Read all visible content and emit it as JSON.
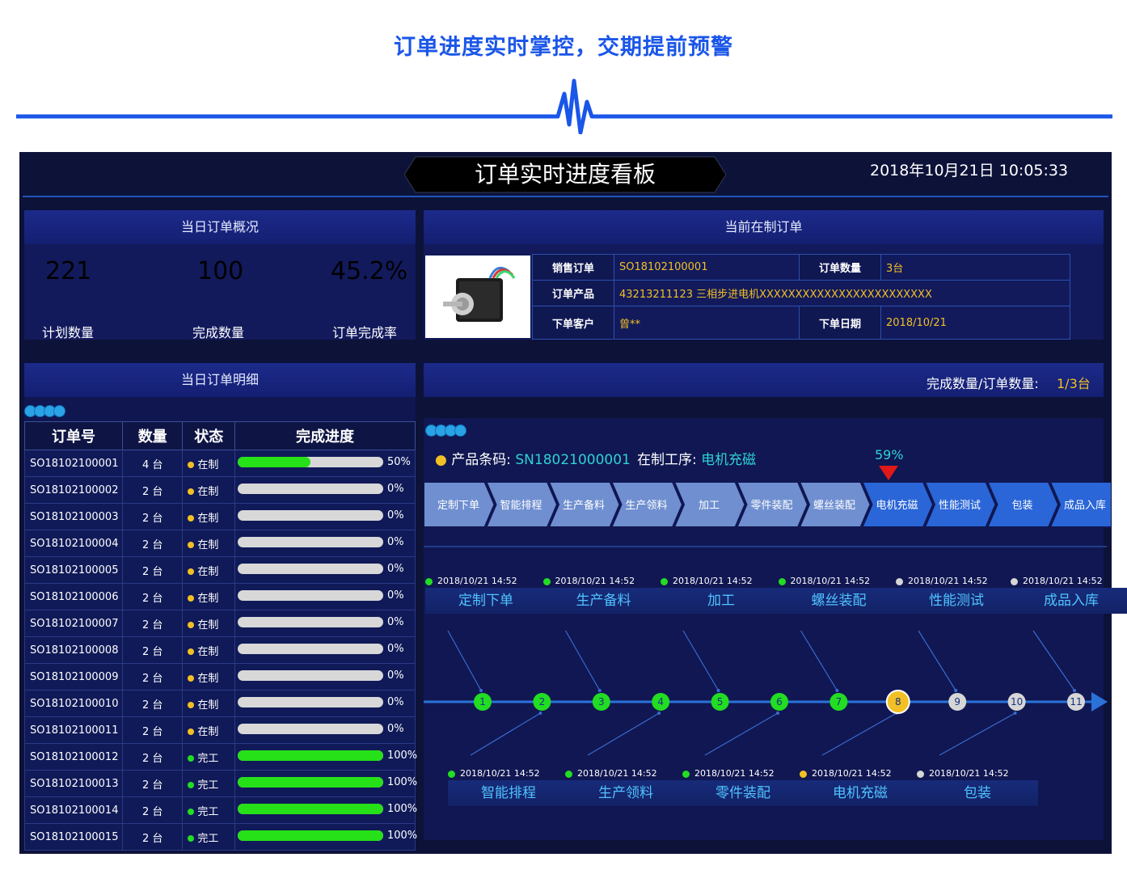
{
  "page_heading": "订单进度实时掌控，交期提前预警",
  "dashboard": {
    "title": "订单实时进度看板",
    "datetime": "2018年10月21日  10:05:33"
  },
  "summary": {
    "title": "当日订单概况",
    "metrics": [
      {
        "value": "221",
        "label": "计划数量",
        "color": "#2fd2d2"
      },
      {
        "value": "100",
        "label": "完成数量",
        "color": "#22dd22"
      },
      {
        "value": "45.2%",
        "label": "订单完成率",
        "color": "#f2c025"
      }
    ]
  },
  "current_order": {
    "title": "当前在制订单",
    "fields": {
      "sales_order_label": "销售订单",
      "sales_order": "SO18102100001",
      "order_qty_label": "订单数量",
      "order_qty": "3台",
      "product_label": "订单产品",
      "product": "43213211123 三相步进电机XXXXXXXXXXXXXXXXXXXXXXXX",
      "customer_label": "下单客户",
      "customer": "曾**",
      "order_date_label": "下单日期",
      "order_date": "2018/10/21"
    }
  },
  "detail": {
    "title": "当日订单明细",
    "columns": [
      "订单号",
      "数量",
      "状态",
      "完成进度"
    ],
    "status_colors": {
      "在制": "#f2c025",
      "完工": "#22dd22"
    },
    "rows": [
      {
        "id": "SO18102100001",
        "qty": "4 台",
        "status": "在制",
        "progress": 50,
        "progress_text": "50%"
      },
      {
        "id": "SO18102100002",
        "qty": "2 台",
        "status": "在制",
        "progress": 0,
        "progress_text": "0%"
      },
      {
        "id": "SO18102100003",
        "qty": "2 台",
        "status": "在制",
        "progress": 0,
        "progress_text": "0%"
      },
      {
        "id": "SO18102100004",
        "qty": "2 台",
        "status": "在制",
        "progress": 0,
        "progress_text": "0%"
      },
      {
        "id": "SO18102100005",
        "qty": "2 台",
        "status": "在制",
        "progress": 0,
        "progress_text": "0%"
      },
      {
        "id": "SO18102100006",
        "qty": "2 台",
        "status": "在制",
        "progress": 0,
        "progress_text": "0%"
      },
      {
        "id": "SO18102100007",
        "qty": "2 台",
        "status": "在制",
        "progress": 0,
        "progress_text": "0%"
      },
      {
        "id": "SO18102100008",
        "qty": "2 台",
        "status": "在制",
        "progress": 0,
        "progress_text": "0%"
      },
      {
        "id": "SO18102100009",
        "qty": "2 台",
        "status": "在制",
        "progress": 0,
        "progress_text": "0%"
      },
      {
        "id": "SO18102100010",
        "qty": "2 台",
        "status": "在制",
        "progress": 0,
        "progress_text": "0%"
      },
      {
        "id": "SO18102100011",
        "qty": "2 台",
        "status": "在制",
        "progress": 0,
        "progress_text": "0%"
      },
      {
        "id": "SO18102100012",
        "qty": "2 台",
        "status": "完工",
        "progress": 100,
        "progress_text": "100%"
      },
      {
        "id": "SO18102100013",
        "qty": "2 台",
        "status": "完工",
        "progress": 100,
        "progress_text": "100%"
      },
      {
        "id": "SO18102100014",
        "qty": "2 台",
        "status": "完工",
        "progress": 100,
        "progress_text": "100%"
      },
      {
        "id": "SO18102100015",
        "qty": "2 台",
        "status": "完工",
        "progress": 100,
        "progress_text": "100%"
      }
    ]
  },
  "process": {
    "completion_label": "完成数量/订单数量:",
    "completion_value": "1/3台",
    "barcode_label": "产品条码:",
    "barcode": "SN18021000001",
    "current_step_label": "在制工序:",
    "current_step": "电机充磁",
    "current_progress": "59%",
    "steps": [
      "定制下单",
      "智能排程",
      "生产备料",
      "生产领料",
      "加工",
      "零件装配",
      "螺丝装配",
      "电机充磁",
      "性能测试",
      "包装",
      "成品入库"
    ],
    "completed_steps": 7,
    "timeline": [
      {
        "n": "1",
        "time": "2018/10/21 14:52",
        "name": "定制下单",
        "status": "done"
      },
      {
        "n": "2",
        "time": "2018/10/21 14:52",
        "name": "智能排程",
        "status": "done"
      },
      {
        "n": "3",
        "time": "2018/10/21 14:52",
        "name": "生产备料",
        "status": "done"
      },
      {
        "n": "4",
        "time": "2018/10/21 14:52",
        "name": "生产领料",
        "status": "done"
      },
      {
        "n": "5",
        "time": "2018/10/21 14:52",
        "name": "加工",
        "status": "done"
      },
      {
        "n": "6",
        "time": "2018/10/21 14:52",
        "name": "零件装配",
        "status": "done"
      },
      {
        "n": "7",
        "time": "2018/10/21 14:52",
        "name": "螺丝装配",
        "status": "done"
      },
      {
        "n": "8",
        "time": "2018/10/21 14:52",
        "name": "电机充磁",
        "status": "current"
      },
      {
        "n": "9",
        "time": "2018/10/21 14:52",
        "name": "性能测试",
        "status": "pending"
      },
      {
        "n": "10",
        "time": "2018/10/21 14:52",
        "name": "包装",
        "status": "pending"
      },
      {
        "n": "11",
        "time": "2018/10/21 14:52",
        "name": "成品入库",
        "status": "pending"
      }
    ],
    "node_colors": {
      "done": "#22dd22",
      "current": "#f2c025",
      "pending": "#d6d6d6"
    }
  }
}
